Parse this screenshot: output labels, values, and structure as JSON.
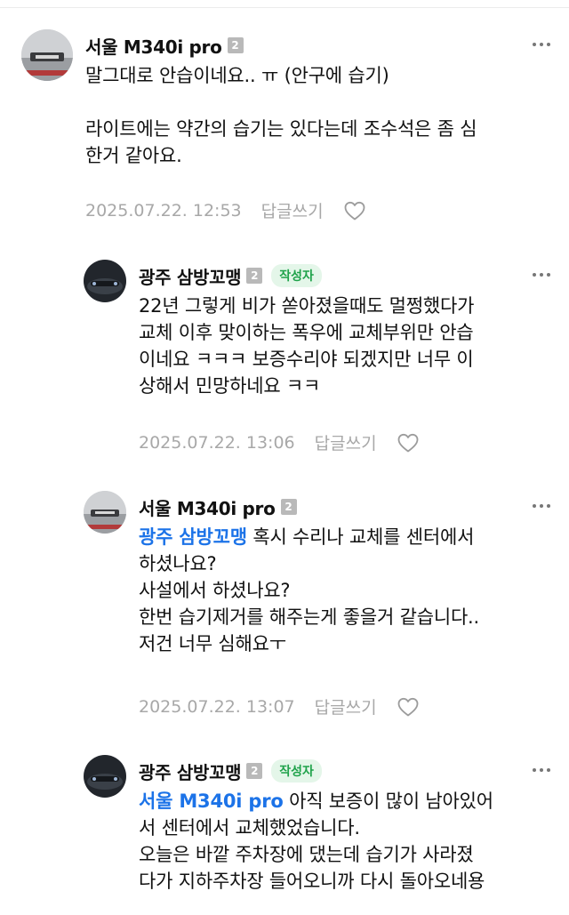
{
  "comments": [
    {
      "author": "서울 M340i pro",
      "level": "2",
      "lines": [
        "말그대로 안습이네요.. ㅠ (안구에 습기)",
        "",
        "라이트에는 약간의 습기는 있다는데 조수석은 좀 심",
        "한거 같아요."
      ],
      "date": "2025.07.22. 12:53",
      "reply_label": "답글쓰기"
    },
    {
      "author": "광주 삼방꼬맹",
      "level": "2",
      "badge": "작성자",
      "lines": [
        "22년 그렇게 비가 쏟아졌을때도 멀쩡했다가",
        "교체 이후 맞이하는 폭우에 교체부위만 안습",
        "이네요 ㅋㅋㅋ 보증수리야 되겠지만 너무 이",
        "상해서 민망하네요 ㅋㅋ"
      ],
      "date": "2025.07.22. 13:06",
      "reply_label": "답글쓰기"
    },
    {
      "author": "서울 M340i pro",
      "level": "2",
      "mention": "광주 삼방꼬맹",
      "first_line_rest": " 혹시 수리나 교체를 센터에서",
      "lines": [
        "하셨나요?",
        "사설에서 하셨나요?",
        "한번 습기제거를 해주는게 좋을거 같습니다..",
        "저건 너무 심해요ㅜ"
      ],
      "date": "2025.07.22. 13:07",
      "reply_label": "답글쓰기"
    },
    {
      "author": "광주 삼방꼬맹",
      "level": "2",
      "badge": "작성자",
      "mention": "서울 M340i pro",
      "first_line_rest": " 아직 보증이 많이 남아있어",
      "lines": [
        "서 센터에서 교체했었습니다.",
        "오늘은 바깥 주차장에 댔는데 습기가 사라졌",
        "다가 지하주차장 들어오니까 다시 돌아오네용"
      ]
    }
  ],
  "colors": {
    "mention": "#1c73e8",
    "badge_text": "#1fa24a",
    "badge_bg": "#e4f6e9",
    "meta": "#a8a8a8"
  },
  "icons": {
    "more": "more-vertical-icon",
    "like": "heart-outline-icon"
  }
}
